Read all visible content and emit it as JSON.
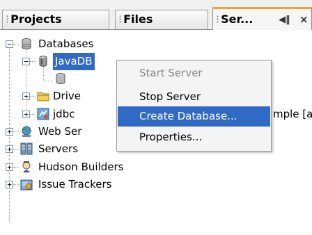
{
  "tabs": [
    {
      "label": "Projects",
      "active": false
    },
    {
      "label": "Files",
      "active": false
    },
    {
      "label": "Ser...",
      "active": true
    }
  ],
  "tab_controls": {
    "restore_icon": "restore-window-icon",
    "close": "×"
  },
  "tree": {
    "databases": "Databases",
    "javadb": "JavaDB",
    "drivers": "Drive",
    "jdbc": "jdbc",
    "jdbc_suffix": "mple [ap",
    "web_services": "Web Ser",
    "servers": "Servers",
    "hudson": "Hudson Builders",
    "issue_trackers": "Issue Trackers"
  },
  "context_menu": {
    "items": [
      {
        "label": "Start Server",
        "enabled": false
      },
      {
        "label": "Stop Server",
        "enabled": true
      },
      {
        "label": "Create Database...",
        "enabled": true,
        "highlighted": true
      },
      {
        "label": "Properties...",
        "enabled": true
      }
    ]
  },
  "colors": {
    "selection": "#316ac5",
    "active_tab_accent": "#f2a23a"
  }
}
